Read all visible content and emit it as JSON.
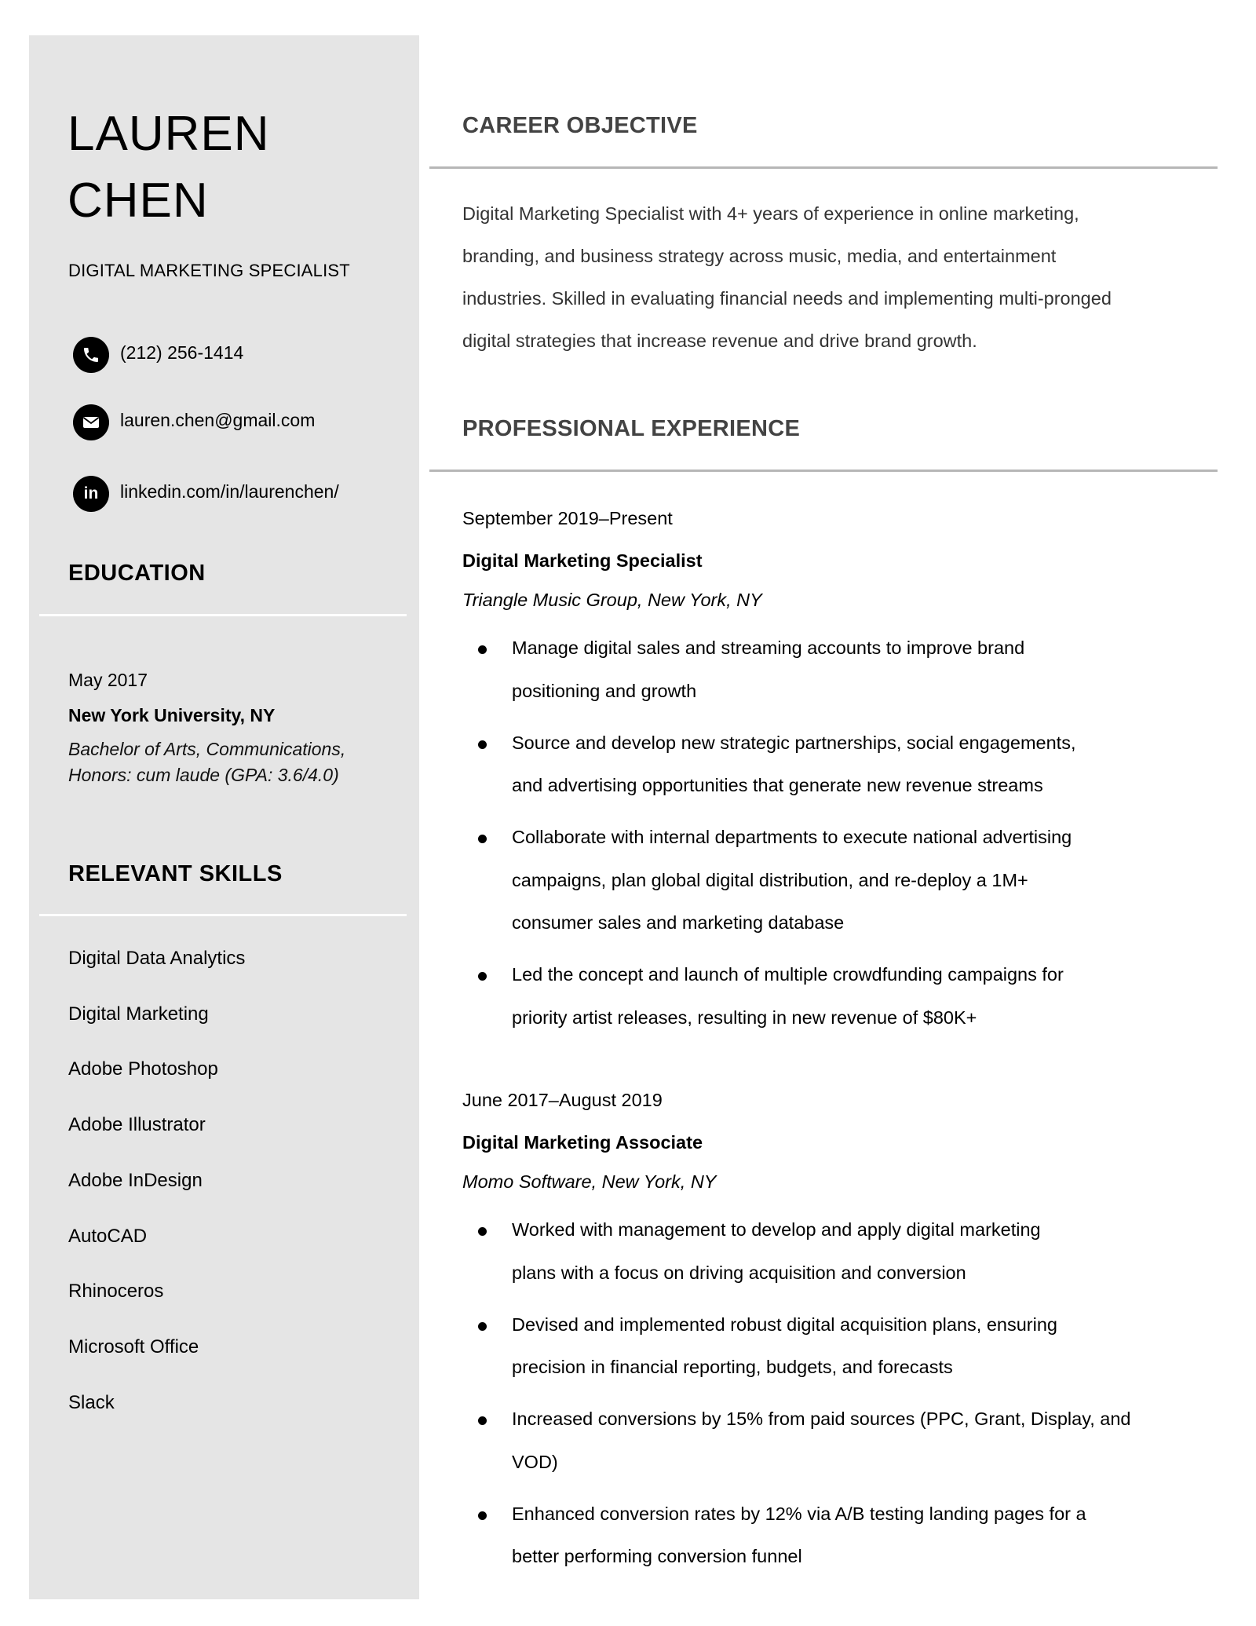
{
  "colors": {
    "sidebar_bg": "#e5e5e5",
    "main_heading": "#434343",
    "main_divider": "#b7b7b7",
    "sidebar_divider": "#ffffff",
    "body_text": "#333333"
  },
  "profile": {
    "first_name": "LAUREN",
    "last_name": "CHEN",
    "title": "DIGITAL MARKETING SPECIALIST"
  },
  "contact": [
    {
      "icon": "phone-icon",
      "text": "(212) 256-1414"
    },
    {
      "icon": "email-icon",
      "text": "lauren.chen@gmail.com"
    },
    {
      "icon": "linkedin-icon",
      "text": "linkedin.com/in/laurenchen/",
      "glyph": "in"
    }
  ],
  "education": {
    "heading": "EDUCATION",
    "date": "May 2017",
    "school": "New York University, NY",
    "degree_lines": [
      "Bachelor of Arts, Communications,",
      "Honors: cum laude (GPA: 3.6/4.0)"
    ]
  },
  "skills": {
    "heading": "RELEVANT SKILLS",
    "items": [
      "Digital Data Analytics",
      "Digital Marketing",
      "Adobe Photoshop",
      "Adobe Illustrator",
      "Adobe InDesign",
      "AutoCAD",
      "Rhinoceros",
      "Microsoft Office",
      "Slack"
    ]
  },
  "objective": {
    "heading": "CAREER OBJECTIVE",
    "lines": [
      "Digital Marketing Specialist with 4+ years of experience in online marketing,",
      "branding, and business strategy across music, media, and entertainment",
      "industries. Skilled in evaluating financial needs and implementing multi-pronged",
      "digital strategies that increase revenue and drive brand growth."
    ]
  },
  "experience": {
    "heading": "PROFESSIONAL EXPERIENCE",
    "jobs": [
      {
        "dates": "September 2019–Present",
        "title": "Digital Marketing Specialist",
        "company": "Triangle Music Group, New York, NY",
        "bullets": [
          [
            "Manage digital sales and streaming accounts to improve brand",
            "positioning and growth"
          ],
          [
            "Source and develop new strategic partnerships, social engagements,",
            "and advertising opportunities that generate new revenue streams"
          ],
          [
            "Collaborate with internal departments to execute national advertising",
            "campaigns, plan global digital distribution, and re-deploy a 1M+",
            "consumer sales and marketing database"
          ],
          [
            "Led the concept and launch of multiple crowdfunding campaigns for",
            "priority artist releases, resulting in new revenue of $80K+"
          ]
        ]
      },
      {
        "dates": "June 2017–August 2019",
        "title": "Digital Marketing Associate",
        "company": "Momo Software, New York, NY",
        "bullets": [
          [
            "Worked with management to develop and apply digital marketing",
            "plans with a focus on driving acquisition and conversion"
          ],
          [
            "Devised and implemented robust digital acquisition plans, ensuring",
            "precision in financial reporting, budgets, and forecasts"
          ],
          [
            "Increased conversions by 15% from paid sources (PPC, Grant, Display, and",
            "VOD)"
          ],
          [
            "Enhanced conversion rates by 12% via A/B testing landing pages for a",
            "better performing conversion funnel"
          ]
        ]
      }
    ]
  }
}
